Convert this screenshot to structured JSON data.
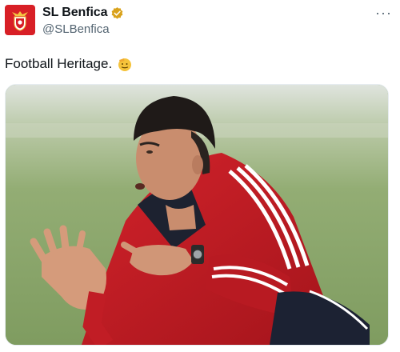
{
  "account": {
    "display_name": "SL Benfica",
    "handle": "@SLBenfica",
    "verified_badge_color": "#d9a21b",
    "avatar_color": "#d81f26"
  },
  "tweet": {
    "text": "Football Heritage.",
    "emoji_icon": "saluting-face-emoji",
    "more_icon": "ellipsis-icon",
    "more_label": "···"
  },
  "media": {
    "kind": "photo"
  }
}
